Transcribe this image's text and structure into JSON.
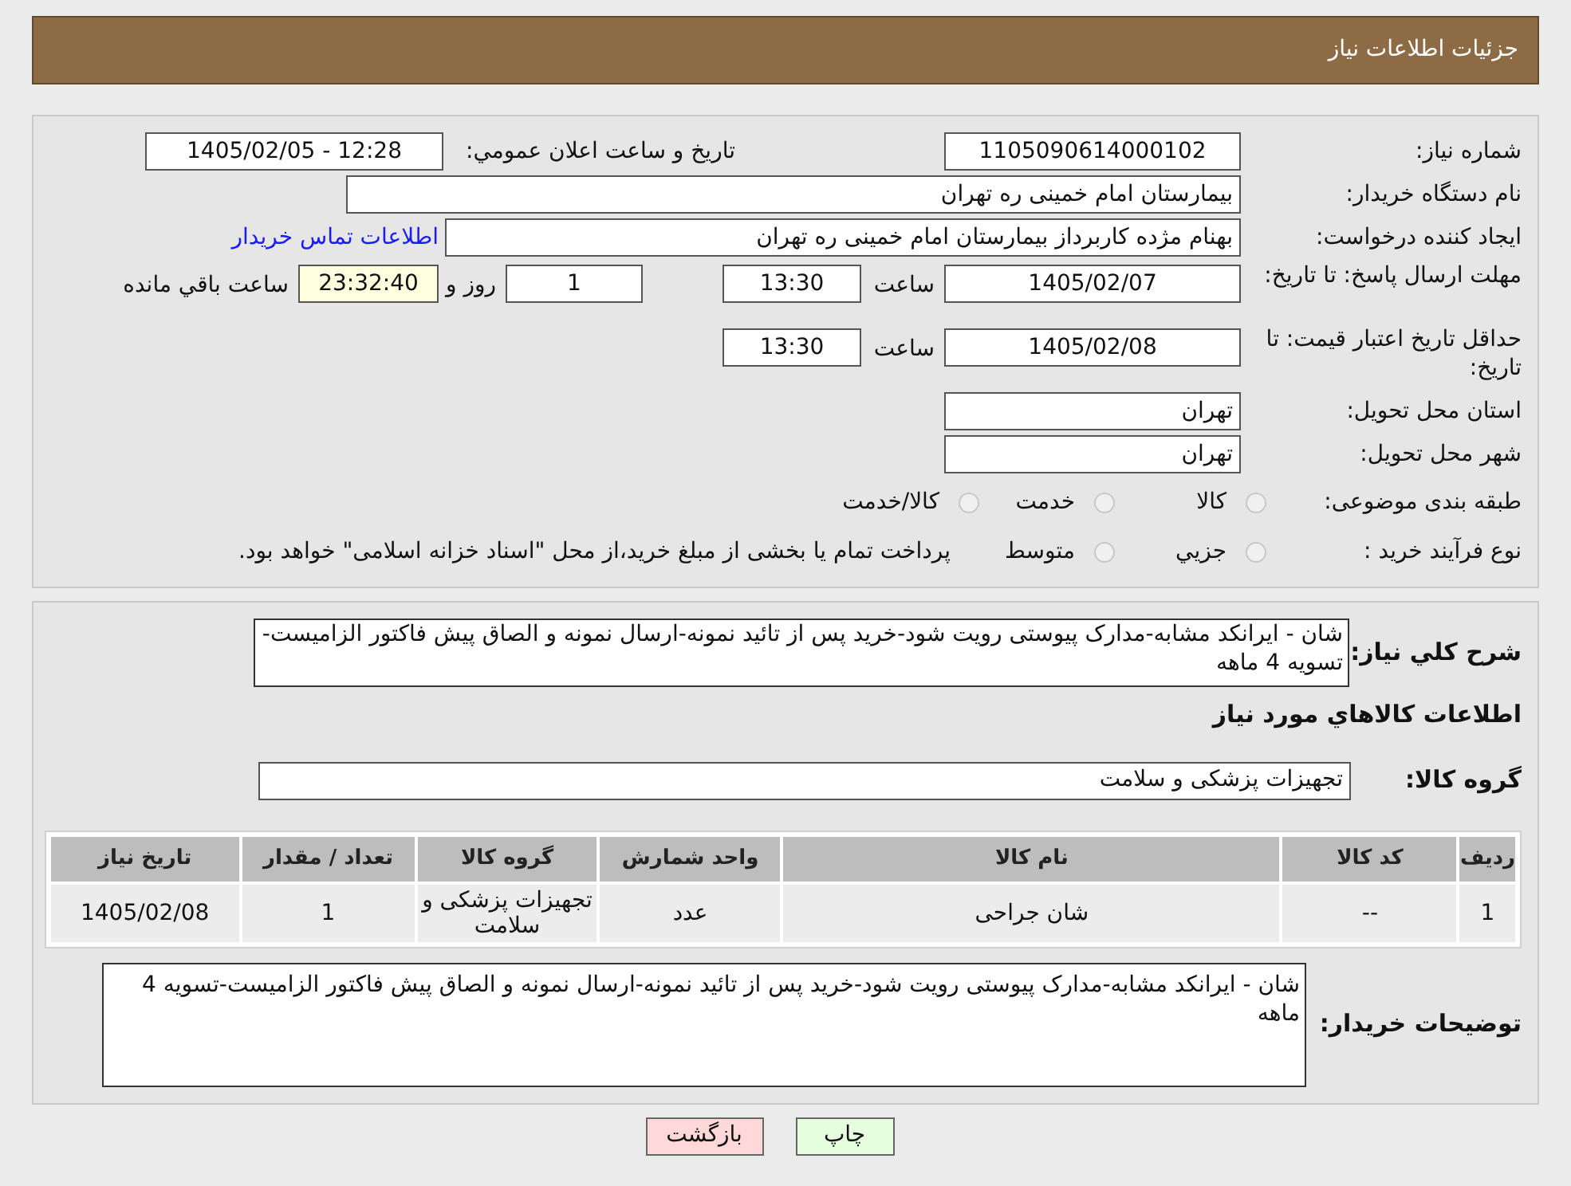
{
  "header": {
    "title": "جزئیات اطلاعات نیاز"
  },
  "need_number": {
    "label": "شماره نیاز:",
    "value": "1105090614000102"
  },
  "announce": {
    "label": "تاریخ و ساعت اعلان عمومي:",
    "value": "1405/02/05 - 12:28"
  },
  "buyer": {
    "label": "نام دستگاه خریدار:",
    "value": "بیمارستان امام خمینی ره  تهران"
  },
  "requester": {
    "label": "ایجاد کننده درخواست:",
    "value": "بهنام مژده کاربرداز بیمارستان امام خمینی ره  تهران",
    "link": "اطلاعات تماس خریدار"
  },
  "deadline": {
    "label": "مهلت ارسال پاسخ: تا تاریخ:",
    "date": "1405/02/07",
    "time_label": "ساعت",
    "time": "13:30",
    "days": "1",
    "days_label": "روز و",
    "remaining": "23:32:40",
    "remaining_label": "ساعت باقي مانده"
  },
  "validity": {
    "label": "حداقل تاریخ اعتبار قیمت: تا تاریخ:",
    "date": "1405/02/08",
    "time_label": "ساعت",
    "time": "13:30"
  },
  "province": {
    "label": "استان محل تحویل:",
    "value": "تهران"
  },
  "city": {
    "label": "شهر محل تحویل:",
    "value": "تهران"
  },
  "category": {
    "label": "طبقه بندی موضوعی:",
    "options": [
      {
        "label": "کالا",
        "selected": false
      },
      {
        "label": "خدمت",
        "selected": false
      },
      {
        "label": "کالا/خدمت",
        "selected": false
      }
    ]
  },
  "process": {
    "label": "نوع فرآیند خرید :",
    "options": [
      {
        "label": "جزيي",
        "selected": false
      },
      {
        "label": "متوسط",
        "selected": false
      }
    ],
    "note": "پرداخت تمام یا بخشی از مبلغ خرید،از محل \"اسناد خزانه اسلامی\" خواهد بود."
  },
  "description": {
    "label": "شرح كلي نياز:",
    "value": "شان - ایرانکد مشابه-مدارک پیوستی رویت شود-خرید پس از تائید نمونه-ارسال نمونه و الصاق پیش فاکتور الزامیست-تسویه 4 ماهه"
  },
  "items_title": "اطلاعات كالاهاي مورد نياز",
  "group": {
    "label": "گروه کالا:",
    "value": "تجهیزات پزشکی و سلامت"
  },
  "table": {
    "columns": [
      "ردیف",
      "کد کالا",
      "نام کالا",
      "واحد شمارش",
      "گروه کالا",
      "تعداد / مقدار",
      "تاریخ نیاز"
    ],
    "rows": [
      [
        "1",
        "--",
        "شان جراحی",
        "عدد",
        "تجهیزات پزشکی و سلامت",
        "1",
        "1405/02/08"
      ]
    ]
  },
  "buyer_notes": {
    "label": "توضیحات خریدار:",
    "value": "شان - ایرانکد مشابه-مدارک پیوستی رویت شود-خرید پس از تائید نمونه-ارسال نمونه و الصاق پیش فاکتور الزامیست-تسویه 4 ماهه"
  },
  "buttons": [
    {
      "label": "چاپ",
      "kind": "print"
    },
    {
      "label": "بازگشت",
      "kind": "back"
    }
  ]
}
